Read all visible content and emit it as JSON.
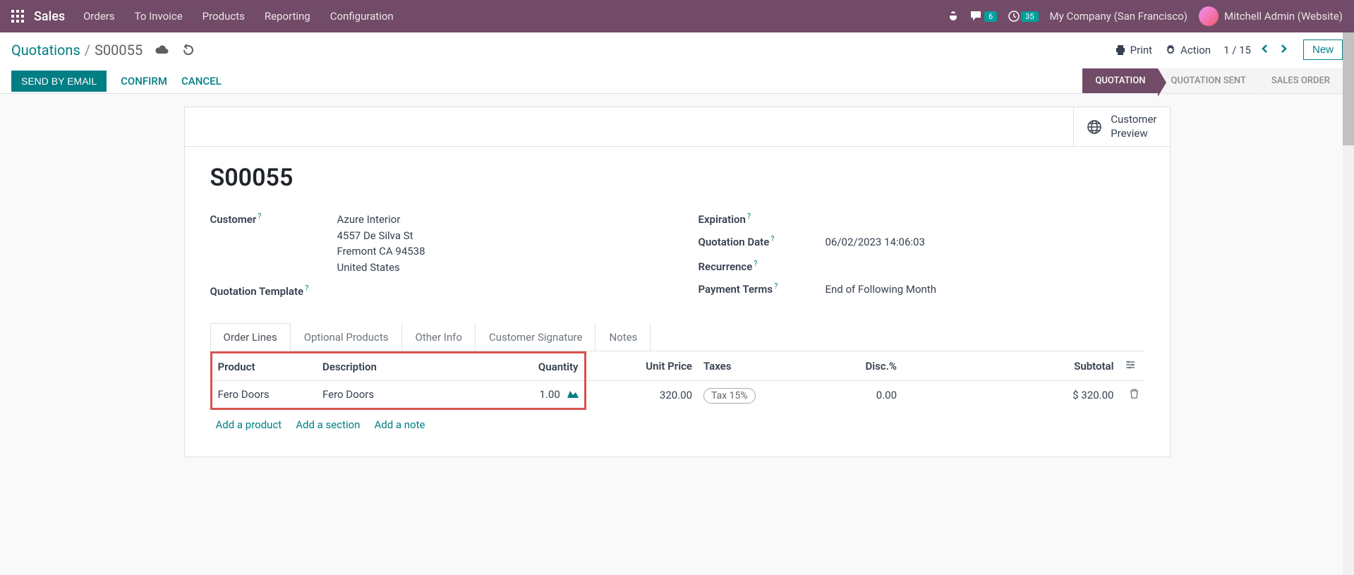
{
  "topnav": {
    "app_name": "Sales",
    "menu": [
      "Orders",
      "To Invoice",
      "Products",
      "Reporting",
      "Configuration"
    ],
    "msg_badge": "6",
    "activity_badge": "35",
    "company": "My Company (San Francisco)",
    "user": "Mitchell Admin (Website)"
  },
  "breadcrumb": {
    "parent": "Quotations",
    "current": "S00055"
  },
  "control": {
    "print": "Print",
    "action": "Action",
    "pager": "1 / 15",
    "new_btn": "New",
    "send_email": "SEND BY EMAIL",
    "confirm": "CONFIRM",
    "cancel": "CANCEL"
  },
  "status": {
    "quotation": "QUOTATION",
    "quotation_sent": "QUOTATION SENT",
    "sales_order": "SALES ORDER"
  },
  "stat_button": {
    "line1": "Customer",
    "line2": "Preview"
  },
  "form": {
    "title": "S00055",
    "labels": {
      "customer": "Customer",
      "quotation_template": "Quotation Template",
      "expiration": "Expiration",
      "quotation_date": "Quotation Date",
      "recurrence": "Recurrence",
      "payment_terms": "Payment Terms"
    },
    "customer": {
      "name": "Azure Interior",
      "street": "4557 De Silva St",
      "city": "Fremont CA 94538",
      "country": "United States"
    },
    "quotation_date": "06/02/2023 14:06:03",
    "payment_terms": "End of Following Month"
  },
  "tabs": [
    "Order Lines",
    "Optional Products",
    "Other Info",
    "Customer Signature",
    "Notes"
  ],
  "table": {
    "headers": {
      "product": "Product",
      "description": "Description",
      "quantity": "Quantity",
      "unit_price": "Unit Price",
      "taxes": "Taxes",
      "disc": "Disc.%",
      "subtotal": "Subtotal"
    },
    "rows": [
      {
        "product": "Fero Doors",
        "description": "Fero Doors",
        "quantity": "1.00",
        "unit_price": "320.00",
        "tax": "Tax 15%",
        "disc": "0.00",
        "subtotal": "$ 320.00"
      }
    ],
    "add_product": "Add a product",
    "add_section": "Add a section",
    "add_note": "Add a note"
  }
}
